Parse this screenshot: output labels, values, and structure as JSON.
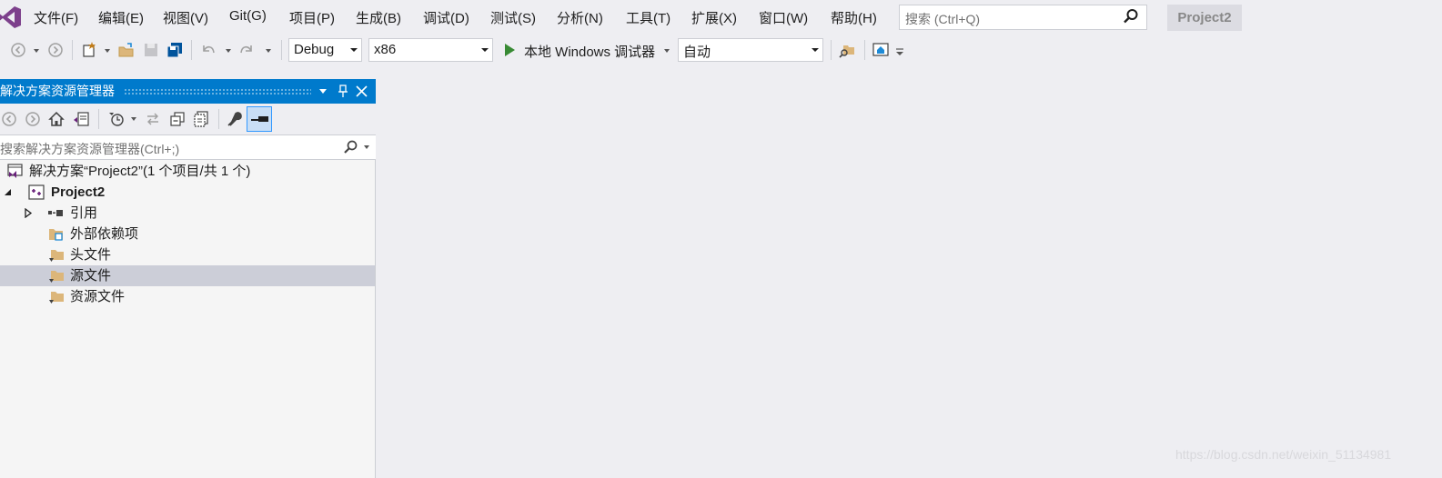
{
  "menu": {
    "items": [
      "文件(F)",
      "编辑(E)",
      "视图(V)",
      "Git(G)",
      "项目(P)",
      "生成(B)",
      "调试(D)",
      "测试(S)",
      "分析(N)",
      "工具(T)",
      "扩展(X)",
      "窗口(W)",
      "帮助(H)"
    ],
    "search_placeholder": "搜索 (Ctrl+Q)",
    "project_name": "Project2"
  },
  "toolbar": {
    "config": "Debug",
    "platform": "x86",
    "debugger": "本地 Windows 调试器",
    "mode": "自动"
  },
  "solution_explorer": {
    "title": "解决方案资源管理器",
    "search_placeholder": "搜索解决方案资源管理器(Ctrl+;)",
    "solution_label": "解决方案“Project2”(1 个项目/共 1 个)",
    "project_label": "Project2",
    "items": [
      "引用",
      "外部依赖项",
      "头文件",
      "源文件",
      "资源文件"
    ],
    "selected_item": "源文件"
  },
  "colors": {
    "accent": "#007acc",
    "background": "#eeeef2",
    "selected_row": "#ccced8",
    "run_green": "#388a34"
  },
  "watermark": "https://blog.csdn.net/weixin_51134981"
}
